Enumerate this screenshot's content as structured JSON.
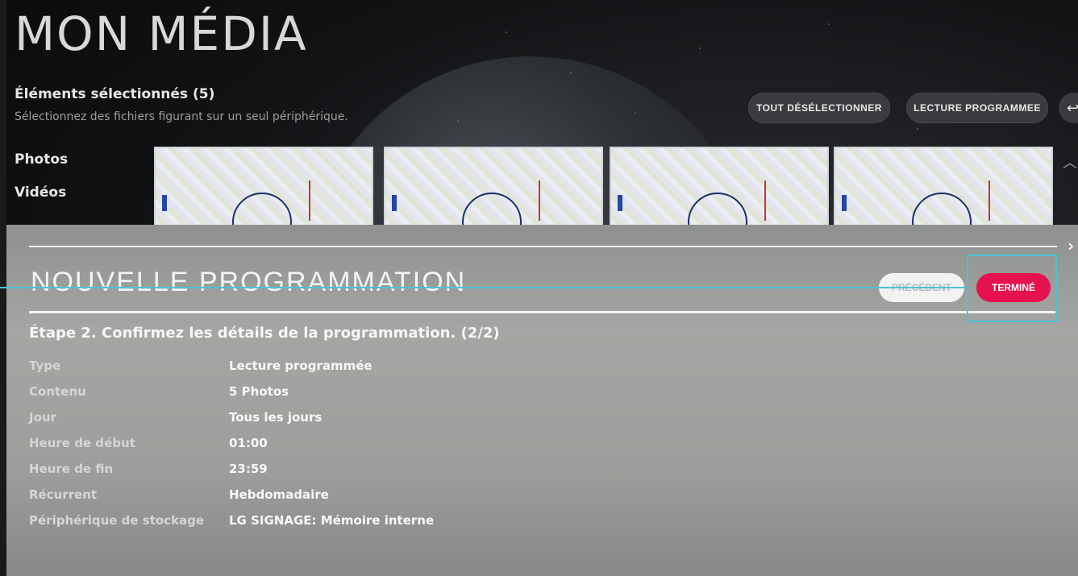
{
  "header": {
    "title": "MON MÉDIA",
    "selected_count": "Éléments sélectionnés (5)",
    "selected_hint": "Sélectionnez des fichiers figurant sur un seul périphérique."
  },
  "toolbar": {
    "deselect_all": "TOUT DÉSÉLECTIONNER",
    "scheduled_playback": "LECTURE PROGRAMMEE"
  },
  "categories": [
    "Photos",
    "Vidéos"
  ],
  "dialog": {
    "title": "NOUVELLE PROGRAMMATION",
    "prev_label": "PRÉCÉDENT",
    "done_label": "TERMINÉ",
    "step": "Étape 2. Confirmez les détails de la programmation. (2/2)",
    "rows": [
      {
        "label": "Type",
        "value": "Lecture programmée"
      },
      {
        "label": "Contenu",
        "value": "5 Photos"
      },
      {
        "label": "Jour",
        "value": "Tous les jours"
      },
      {
        "label": "Heure de début",
        "value": "01:00"
      },
      {
        "label": "Heure de fin",
        "value": "23:59"
      },
      {
        "label": "Récurrent",
        "value": "Hebdomadaire"
      },
      {
        "label": "Périphérique de stockage",
        "value": "LG SIGNAGE: Mémoire interne"
      }
    ]
  },
  "colors": {
    "accent": "#e5124f",
    "annotation": "#4cc3d4"
  },
  "icons": {
    "back": "back-arrow-icon",
    "scroll_up": "chevron-up-icon",
    "close": "close-icon"
  }
}
